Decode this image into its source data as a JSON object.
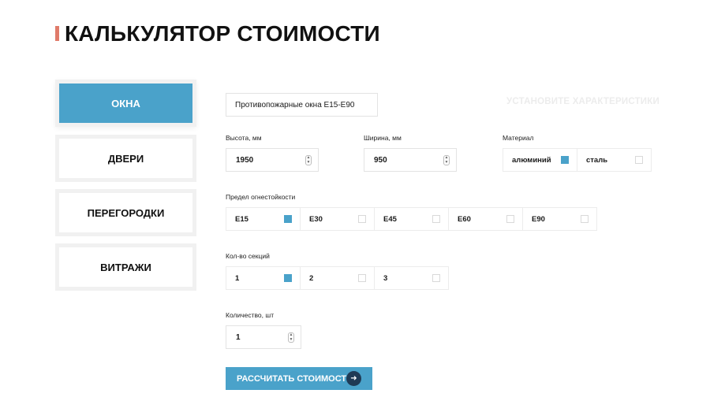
{
  "page": {
    "title": "КАЛЬКУЛЯТОР СТОИМОСТИ"
  },
  "categories": [
    {
      "label": "ОКНА",
      "active": true
    },
    {
      "label": "ДВЕРИ",
      "active": false
    },
    {
      "label": "ПЕРЕГОРОДКИ",
      "active": false
    },
    {
      "label": "ВИТРАЖИ",
      "active": false
    }
  ],
  "product": {
    "type_value": "Противопожарные окна Е15-Е90"
  },
  "hint": "УСТАНОВИТЕ ХАРАКТЕРИСТИКИ",
  "height": {
    "label": "Высота, мм",
    "value": "1950"
  },
  "width": {
    "label": "Ширина, мм",
    "value": "950"
  },
  "material": {
    "label": "Материал",
    "options": [
      {
        "label": "алюминий",
        "checked": true
      },
      {
        "label": "сталь",
        "checked": false
      }
    ]
  },
  "fire_limit": {
    "label": "Предел огнестойкости",
    "options": [
      {
        "label": "E15",
        "checked": true
      },
      {
        "label": "E30",
        "checked": false
      },
      {
        "label": "E45",
        "checked": false
      },
      {
        "label": "E60",
        "checked": false
      },
      {
        "label": "E90",
        "checked": false
      }
    ]
  },
  "sections": {
    "label": "Кол-во секций",
    "options": [
      {
        "label": "1",
        "checked": true
      },
      {
        "label": "2",
        "checked": false
      },
      {
        "label": "3",
        "checked": false
      }
    ]
  },
  "quantity": {
    "label": "Количество, шт",
    "value": "1"
  },
  "calc_button": {
    "label": "РАССЧИТАТЬ СТОИМОСТЬ"
  },
  "colors": {
    "accent": "#4aa2ca",
    "title_marker": "#e07b6a",
    "arrow_circle": "#1f3a55"
  },
  "icons": {
    "spinner": "spinner-arrows-icon",
    "arrow": "arrow-right-icon"
  }
}
